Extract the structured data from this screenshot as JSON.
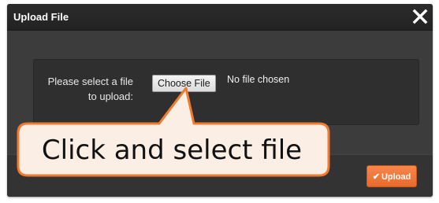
{
  "dialog": {
    "title": "Upload File",
    "close_icon": "close-icon"
  },
  "form": {
    "prompt_line1": "Please select a file",
    "prompt_line2": "to upload:",
    "choose_file_label": "Choose File",
    "file_status": "No file chosen"
  },
  "footer": {
    "upload_label": "Upload",
    "upload_icon": "check-icon"
  },
  "callout": {
    "text": "Click and select file",
    "border_color": "#f07a2e",
    "fill_color": "#fbeee4"
  },
  "colors": {
    "accent": "#f07a2e",
    "dialog_bg": "#3a3a3a",
    "titlebar_bg": "#252525"
  }
}
